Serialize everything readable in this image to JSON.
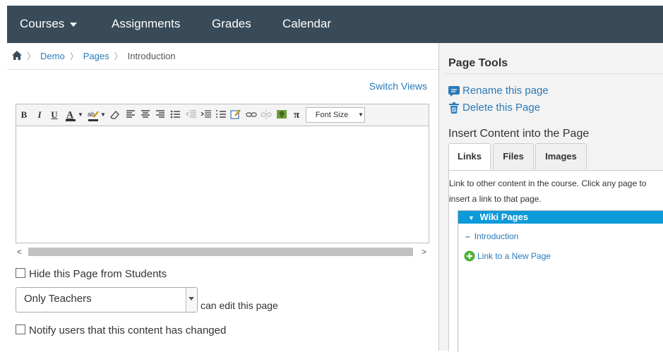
{
  "nav": {
    "items": [
      {
        "label": "Courses"
      },
      {
        "label": "Assignments"
      },
      {
        "label": "Grades"
      },
      {
        "label": "Calendar"
      }
    ]
  },
  "breadcrumb": [
    "Demo",
    "Pages",
    "Introduction"
  ],
  "editor": {
    "switch_views": "Switch Views",
    "font_size_label": "Font Size",
    "toolbar_icons": [
      "bold-icon",
      "italic-icon",
      "underline-icon",
      "font-color-icon",
      "highlight-color-icon",
      "eraser-icon",
      "align-left-icon",
      "align-center-icon",
      "align-right-icon",
      "bullet-list-icon",
      "outdent-icon",
      "indent-icon",
      "numbered-list-icon",
      "edit-icon",
      "link-icon",
      "unlink-icon",
      "image-icon",
      "math-icon"
    ]
  },
  "options": {
    "hide_label": "Hide this Page from Students",
    "editors_select": "Only Teachers",
    "can_edit_label": "can edit this page",
    "notify_label": "Notify users that this content has changed"
  },
  "page_tools": {
    "title": "Page Tools",
    "rename": "Rename this page",
    "delete": "Delete this Page",
    "insert_title": "Insert Content into the Page",
    "tabs": [
      "Links",
      "Files",
      "Images"
    ],
    "description": "Link to other content in the course. Click any page to insert a link to that page.",
    "tree_header": "Wiki Pages",
    "tree_items": [
      "Introduction"
    ],
    "new_page_link": "Link to a New Page"
  },
  "colors": {
    "nav_bg": "#394b58",
    "link": "#2a7ab8",
    "tree_header": "#0c9ad9"
  }
}
